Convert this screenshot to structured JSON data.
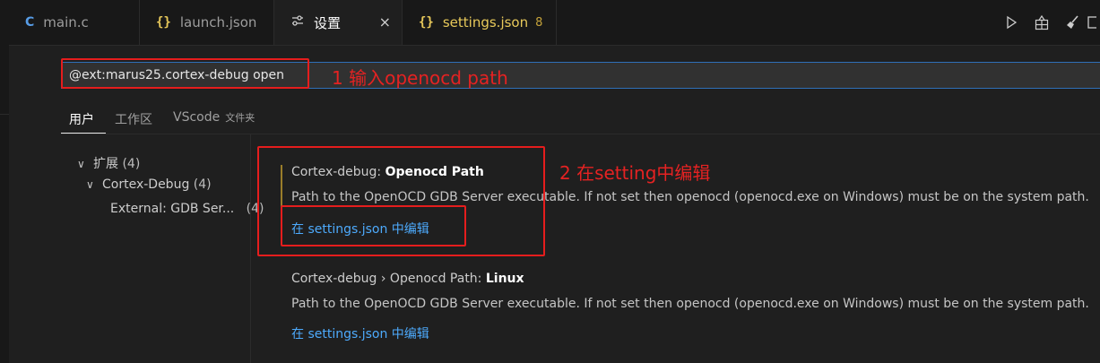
{
  "tabs": [
    {
      "icon": "C",
      "label": "main.c"
    },
    {
      "icon": "{}",
      "label": "launch.json"
    },
    {
      "icon": "settings-icon",
      "label": "设置"
    },
    {
      "icon": "{}",
      "label": "settings.json",
      "badge": "8"
    }
  ],
  "close_glyph": "×",
  "toolbar": {
    "run_icon": "▷",
    "split_icon": "split-icon",
    "clean_icon": "broom-icon",
    "layout_icon": "layout-icon"
  },
  "search": {
    "value": "@ext:marus25.cortex-debug open"
  },
  "annotations": {
    "step1": "1 输入openocd path",
    "step2": "2  在setting中编辑"
  },
  "scope_tabs": {
    "user": "用户",
    "workspace": "工作区",
    "folder_name": "VScode",
    "folder_suffix": "文件夹"
  },
  "tree": {
    "ext_label": "扩展",
    "ext_count": "(4)",
    "cortex_label": "Cortex-Debug",
    "cortex_count": "(4)",
    "external_label": "External: GDB Ser...",
    "external_count": "(4)"
  },
  "settings": [
    {
      "category": "Cortex-debug: ",
      "name": "Openocd Path",
      "description": "Path to the OpenOCD GDB Server executable. If not set then openocd (openocd.exe on Windows) must be on the system path.",
      "link": "在 settings.json 中编辑"
    },
    {
      "category": "Cortex-debug › Openocd Path: ",
      "name": "Linux",
      "description": "Path to the OpenOCD GDB Server executable. If not set then openocd (openocd.exe on Windows) must be on the system path.",
      "link": "在 settings.json 中编辑"
    }
  ],
  "colors": {
    "accent_link": "#4daafc",
    "annotation_red": "#e51d1d",
    "focus_border": "#2f6fb8"
  }
}
